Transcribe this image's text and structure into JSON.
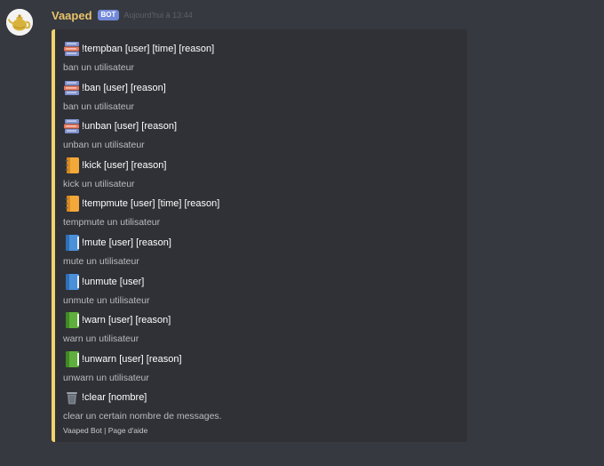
{
  "message": {
    "username": "Vaaped",
    "badge": "BOT",
    "timestamp": "Aujourd'hui à 13:44",
    "embed_color": "#f2d26b",
    "username_color": "#e8c26b"
  },
  "fields": [
    {
      "icon": "books-icon",
      "name": "!tempban [user] [time] [reason]",
      "value": "ban un utilisateur"
    },
    {
      "icon": "books-icon",
      "name": "!ban [user] [reason]",
      "value": "ban un utilisateur"
    },
    {
      "icon": "books-icon",
      "name": "!unban [user] [reason]",
      "value": "unban un utilisateur"
    },
    {
      "icon": "orange-notebook-icon",
      "name": "!kick [user] [reason]",
      "value": "kick un utilisateur"
    },
    {
      "icon": "orange-notebook-icon",
      "name": "!tempmute [user] [time] [reason]",
      "value": "tempmute un utilisateur"
    },
    {
      "icon": "blue-book-icon",
      "name": "!mute [user] [reason]",
      "value": "mute un utilisateur"
    },
    {
      "icon": "blue-book-icon",
      "name": "!unmute [user]",
      "value": "unmute un utilisateur"
    },
    {
      "icon": "green-book-icon",
      "name": "!warn [user] [reason]",
      "value": "warn un utilisateur"
    },
    {
      "icon": "green-book-icon",
      "name": "!unwarn [user] [reason]",
      "value": "unwarn un utilisateur"
    },
    {
      "icon": "wastebasket-icon",
      "name": "!clear [nombre]",
      "value": "clear un certain nombre de messages."
    }
  ],
  "footer": {
    "text": "Vaaped Bot | Page d'aide"
  }
}
